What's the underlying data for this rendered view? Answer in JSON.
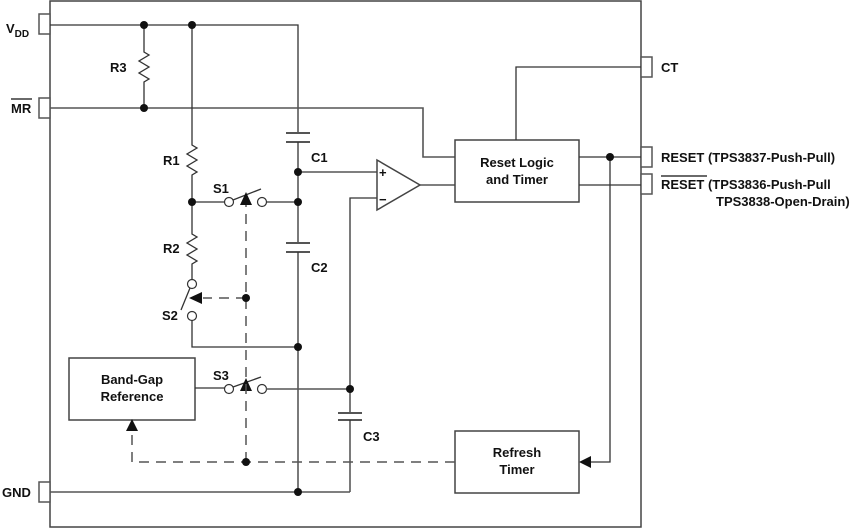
{
  "diagram": {
    "type": "block-diagram",
    "subject": "Supervisory circuit functional block diagram",
    "pins": {
      "vdd": {
        "main": "V",
        "sub": "DD"
      },
      "mr": "MR",
      "gnd": "GND",
      "ct": "CT",
      "reset": "RESET (TPS3837-Push-Pull)",
      "reset_n_name": "RESET",
      "reset_n_line1": " (TPS3836-Push-Pull",
      "reset_n_line2": "TPS3838-Open-Drain)"
    },
    "components": {
      "r1": "R1",
      "r2": "R2",
      "r3": "R3",
      "c1": "C1",
      "c2": "C2",
      "c3": "C3",
      "s1": "S1",
      "s2": "S2",
      "s3": "S3",
      "comparator_plus": "+",
      "comparator_minus": "−"
    },
    "blocks": {
      "reset_logic": {
        "line1": "Reset Logic",
        "line2": "and Timer"
      },
      "bandgap": {
        "line1": "Band-Gap",
        "line2": "Reference"
      },
      "refresh_timer": {
        "line1": "Refresh",
        "line2": "Timer"
      }
    }
  }
}
